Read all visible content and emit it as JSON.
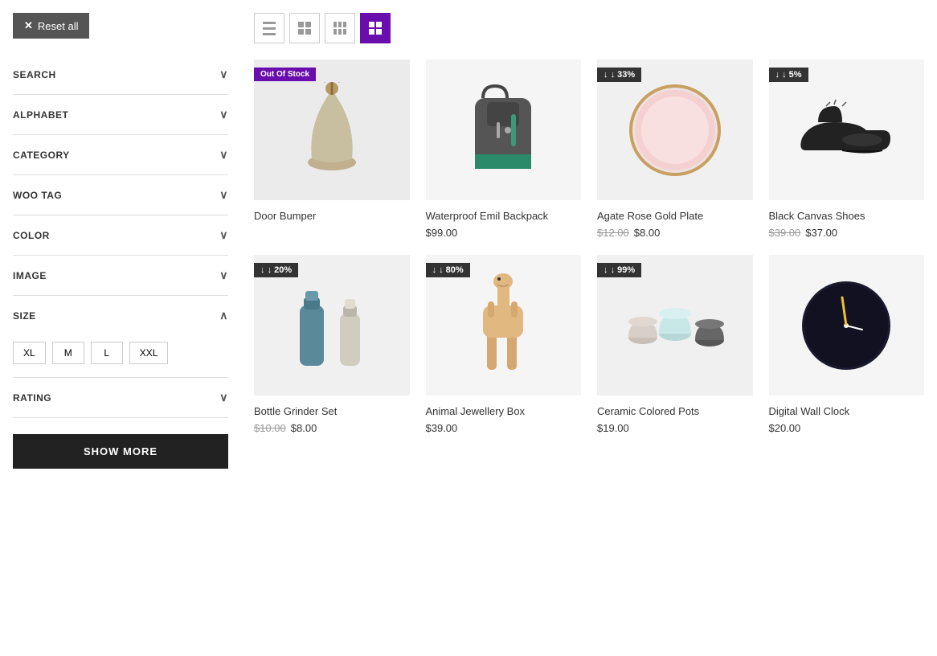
{
  "sidebar": {
    "reset_label": "Reset all",
    "filters": [
      {
        "id": "search",
        "label": "SEARCH",
        "expanded": false
      },
      {
        "id": "alphabet",
        "label": "ALPHABET",
        "expanded": false
      },
      {
        "id": "category",
        "label": "CATEGORY",
        "expanded": false
      },
      {
        "id": "woo-tag",
        "label": "WOO TAG",
        "expanded": false
      },
      {
        "id": "color",
        "label": "COLOR",
        "expanded": false
      },
      {
        "id": "image",
        "label": "IMAGE",
        "expanded": false
      },
      {
        "id": "size",
        "label": "SIZE",
        "expanded": true
      },
      {
        "id": "rating",
        "label": "RATING",
        "expanded": false
      }
    ],
    "size_options": [
      "XL",
      "M",
      "L",
      "XXL"
    ],
    "show_more_label": "SHOW MORE"
  },
  "toolbar": {
    "views": [
      {
        "id": "list",
        "active": false,
        "cols": 2
      },
      {
        "id": "grid3",
        "active": false,
        "cols": 3
      },
      {
        "id": "grid4",
        "active": false,
        "cols": 4
      },
      {
        "id": "grid4b",
        "active": true,
        "cols": 4
      }
    ]
  },
  "products": [
    {
      "id": "door-bumper",
      "name": "Door Bumper",
      "badge": "Out Of Stock",
      "badge_type": "out",
      "price": null,
      "price_old": null,
      "price_new": null,
      "price_display": "",
      "bg_color": "#ebebeb",
      "shape": "bell"
    },
    {
      "id": "waterproof-backpack",
      "name": "Waterproof Emil Backpack",
      "badge": null,
      "badge_type": null,
      "price_display": "$99.00",
      "price_old": null,
      "price_new": null,
      "bg_color": "#f5f5f5",
      "shape": "backpack"
    },
    {
      "id": "agate-rose-gold",
      "name": "Agate Rose Gold Plate",
      "badge": "33%",
      "badge_type": "discount",
      "price_old": "$12.00",
      "price_new": "$8.00",
      "price_display": null,
      "bg_color": "#f0f0f0",
      "shape": "plate"
    },
    {
      "id": "black-canvas-shoes",
      "name": "Black Canvas Shoes",
      "badge": "5%",
      "badge_type": "discount",
      "price_old": "$39.00",
      "price_new": "$37.00",
      "price_display": null,
      "bg_color": "#f5f5f5",
      "shape": "shoes"
    },
    {
      "id": "bottle-grinder",
      "name": "Bottle Grinder Set",
      "badge": "20%",
      "badge_type": "discount",
      "price_old": "$10.00",
      "price_new": "$8.00",
      "price_display": null,
      "bg_color": "#f0f0f0",
      "shape": "bottles"
    },
    {
      "id": "animal-jewellery",
      "name": "Animal Jewellery Box",
      "badge": "80%",
      "badge_type": "discount",
      "price_display": "$39.00",
      "price_old": null,
      "price_new": null,
      "bg_color": "#f5f5f5",
      "shape": "llama"
    },
    {
      "id": "ceramic-pots",
      "name": "Ceramic Colored Pots",
      "badge": "99%",
      "badge_type": "discount",
      "price_display": "$19.00",
      "price_old": null,
      "price_new": null,
      "bg_color": "#f0f0f0",
      "shape": "pots"
    },
    {
      "id": "digital-wall-clock",
      "name": "Digital Wall Clock",
      "badge": null,
      "badge_type": null,
      "price_display": "$20.00",
      "price_old": null,
      "price_new": null,
      "bg_color": "#f5f5f5",
      "shape": "clock"
    }
  ],
  "colors": {
    "accent": "#6a0dad",
    "badge_dark": "#333333",
    "badge_out": "#6a0dad"
  }
}
